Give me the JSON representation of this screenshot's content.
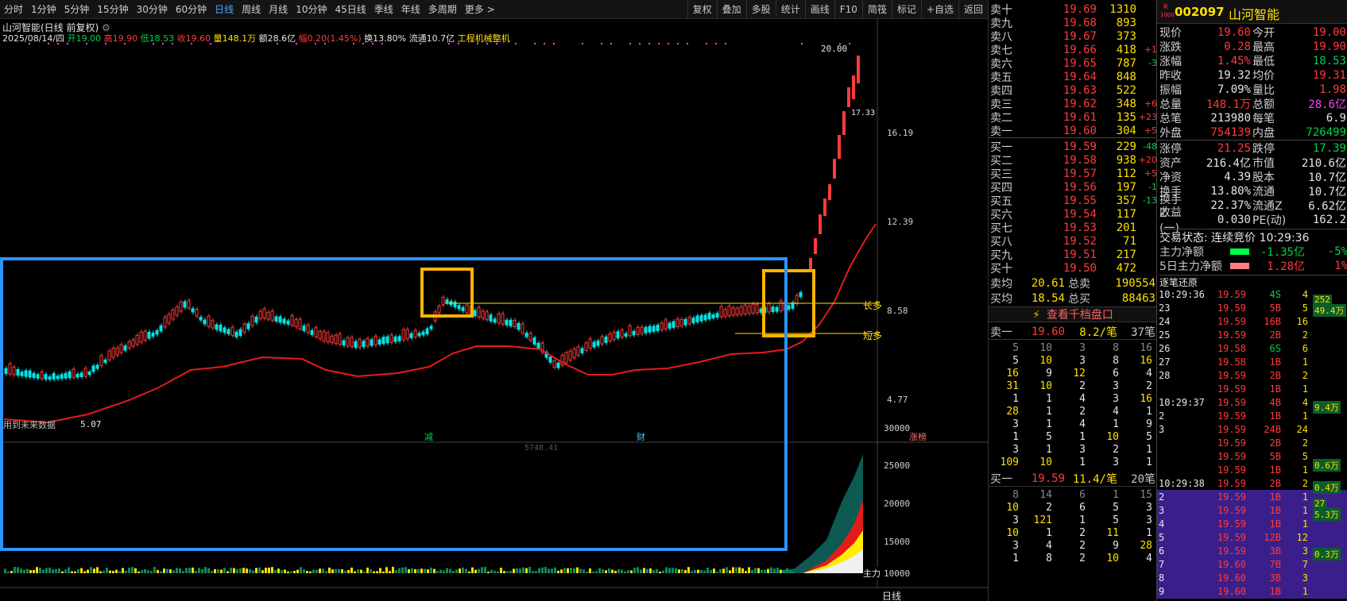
{
  "toolbar": {
    "periods": [
      "分时",
      "1分钟",
      "5分钟",
      "15分钟",
      "30分钟",
      "60分钟",
      "日线",
      "周线",
      "月线",
      "10分钟",
      "45日线",
      "季线",
      "年线",
      "多周期",
      "更多 >"
    ],
    "active_period": "日线",
    "tools": [
      "复权",
      "叠加",
      "多股",
      "统计",
      "画线",
      "F10",
      "简筏",
      "标记",
      "+自选",
      "返回"
    ]
  },
  "chart_header": {
    "title": "山河智能(日线 前复权)",
    "date": "2025/08/14/四",
    "open": "开19.00",
    "high": "高19.90",
    "low": "低18.53",
    "close": "收19.60",
    "volume": "量148.1万",
    "amount": "额28.6亿",
    "change": "幅0.20(1.45%)",
    "turnover": "换13.80%",
    "float": "流通10.7亿",
    "industry": "工程机械整机"
  },
  "price_axis": [
    "16.19",
    "12.39",
    "8.58",
    "4.77"
  ],
  "price_labels": {
    "peak": "20.00",
    "right_marker": "17.33",
    "low_marker": "5.07",
    "long_line": "长多",
    "short_line": "短多"
  },
  "markers": {
    "left_note": "用到未来数据",
    "m1": "减",
    "m2": "财",
    "m3": "涨榜"
  },
  "volume_axis": [
    "30000",
    "25000",
    "20000",
    "15000",
    "10000"
  ],
  "volume_label": "主力",
  "volume_extra": "5748.41",
  "bottom_axis": "日线",
  "orderbook": {
    "asks": [
      {
        "label": "卖十",
        "price": "19.69",
        "vol": "1310",
        "chg": ""
      },
      {
        "label": "卖九",
        "price": "19.68",
        "vol": "893",
        "chg": ""
      },
      {
        "label": "卖八",
        "price": "19.67",
        "vol": "373",
        "chg": ""
      },
      {
        "label": "卖七",
        "price": "19.66",
        "vol": "418",
        "chg": "+1"
      },
      {
        "label": "卖六",
        "price": "19.65",
        "vol": "787",
        "chg": "-3"
      },
      {
        "label": "卖五",
        "price": "19.64",
        "vol": "848",
        "chg": ""
      },
      {
        "label": "卖四",
        "price": "19.63",
        "vol": "522",
        "chg": ""
      },
      {
        "label": "卖三",
        "price": "19.62",
        "vol": "348",
        "chg": "+6"
      },
      {
        "label": "卖二",
        "price": "19.61",
        "vol": "135",
        "chg": "+23"
      },
      {
        "label": "卖一",
        "price": "19.60",
        "vol": "304",
        "chg": "+5"
      }
    ],
    "bids": [
      {
        "label": "买一",
        "price": "19.59",
        "vol": "229",
        "chg": "-48"
      },
      {
        "label": "买二",
        "price": "19.58",
        "vol": "938",
        "chg": "+20"
      },
      {
        "label": "买三",
        "price": "19.57",
        "vol": "112",
        "chg": "+5"
      },
      {
        "label": "买四",
        "price": "19.56",
        "vol": "197",
        "chg": "-1"
      },
      {
        "label": "买五",
        "price": "19.55",
        "vol": "357",
        "chg": "-13"
      },
      {
        "label": "买六",
        "price": "19.54",
        "vol": "117",
        "chg": ""
      },
      {
        "label": "买七",
        "price": "19.53",
        "vol": "201",
        "chg": ""
      },
      {
        "label": "买八",
        "price": "19.52",
        "vol": "71",
        "chg": ""
      },
      {
        "label": "买九",
        "price": "19.51",
        "vol": "217",
        "chg": ""
      },
      {
        "label": "买十",
        "price": "19.50",
        "vol": "472",
        "chg": ""
      }
    ],
    "ask_avg_label": "卖均",
    "ask_avg": "20.61",
    "total_sell_label": "总卖",
    "total_sell": "190554",
    "bid_avg_label": "买均",
    "bid_avg": "18.54",
    "total_buy_label": "总买",
    "total_buy": "88463",
    "depth_button": "查看千档盘口",
    "sell1_summary": {
      "label": "卖一",
      "price": "19.60",
      "per": "8.2/笔",
      "count": "37笔"
    },
    "sell1_grid": [
      [
        "5",
        "10",
        "3",
        "8",
        "16"
      ],
      [
        "5",
        "10",
        "3",
        "8",
        "16"
      ],
      [
        "16",
        "9",
        "12",
        "6",
        "4"
      ],
      [
        "31",
        "10",
        "2",
        "3",
        "2"
      ],
      [
        "1",
        "1",
        "4",
        "3",
        "16"
      ],
      [
        "28",
        "1",
        "2",
        "4",
        "1"
      ],
      [
        "3",
        "1",
        "4",
        "1",
        "9"
      ],
      [
        "1",
        "5",
        "1",
        "10",
        "5"
      ],
      [
        "3",
        "1",
        "3",
        "2",
        "1"
      ],
      [
        "109",
        "10",
        "1",
        "3",
        "1"
      ]
    ],
    "buy1_summary": {
      "label": "买一",
      "price": "19.59",
      "per": "11.4/笔",
      "count": "20笔"
    },
    "buy1_grid": [
      [
        "8",
        "14",
        "6",
        "1",
        "15"
      ],
      [
        "10",
        "2",
        "6",
        "5",
        "3"
      ],
      [
        "3",
        "121",
        "1",
        "5",
        "3"
      ],
      [
        "10",
        "1",
        "2",
        "11",
        "1"
      ],
      [
        "3",
        "4",
        "2",
        "9",
        "28"
      ],
      [
        "1",
        "8",
        "2",
        "10",
        "4"
      ]
    ]
  },
  "quote": {
    "code": "002097",
    "name": "山河智能",
    "rows": [
      {
        "k": "现价",
        "v": "19.60",
        "k2": "今开",
        "v2": "19.00"
      },
      {
        "k": "涨跌",
        "v": "0.28",
        "k2": "最高",
        "v2": "19.90"
      },
      {
        "k": "涨幅",
        "v": "1.45%",
        "k2": "最低",
        "v2": "18.53"
      },
      {
        "k": "昨收",
        "v": "19.32",
        "k2": "均价",
        "v2": "19.31"
      },
      {
        "k": "振幅",
        "v": "7.09%",
        "k2": "量比",
        "v2": "1.98"
      },
      {
        "k": "总量",
        "v": "148.1万",
        "k2": "总额",
        "v2": "28.6亿"
      },
      {
        "k": "总笔",
        "v": "213980",
        "k2": "每笔",
        "v2": "6.9"
      },
      {
        "k": "外盘",
        "v": "754139",
        "k2": "内盘",
        "v2": "726499"
      },
      {
        "k": "涨停",
        "v": "21.25",
        "k2": "跌停",
        "v2": "17.39"
      },
      {
        "k": "资产",
        "v": "216.4亿",
        "k2": "市值",
        "v2": "210.6亿"
      },
      {
        "k": "净资",
        "v": "4.39",
        "k2": "股本",
        "v2": "10.7亿"
      },
      {
        "k": "换手",
        "v": "13.80%",
        "k2": "流通",
        "v2": "10.7亿"
      },
      {
        "k": "换手Z",
        "v": "22.37%",
        "k2": "流通Z",
        "v2": "6.62亿"
      },
      {
        "k": "收益(一)",
        "v": "0.030",
        "k2": "PE(动)",
        "v2": "162.2"
      }
    ],
    "trade_status": "交易状态: 连续竞价 10:29:36",
    "main_net": {
      "label": "主力净额",
      "value": "-1.35亿",
      "pct": "-5%"
    },
    "main_net5": {
      "label": "5日主力净额",
      "value": "1.28亿",
      "pct": "1%"
    }
  },
  "ticks_header": "逐笔还原",
  "ticks": [
    {
      "t": "10:29:36",
      "p": "19.59",
      "v": "4S",
      "n": "4"
    },
    {
      "t": "23",
      "p": "19.59",
      "v": "5B",
      "n": "5"
    },
    {
      "t": "24",
      "p": "19.59",
      "v": "16B",
      "n": "16"
    },
    {
      "t": "25",
      "p": "19.59",
      "v": "2B",
      "n": "2"
    },
    {
      "t": "26",
      "p": "19.58",
      "v": "6S",
      "n": "6"
    },
    {
      "t": "27",
      "p": "19.58",
      "v": "1B",
      "n": "1"
    },
    {
      "t": "28",
      "p": "19.59",
      "v": "2B",
      "n": "2"
    },
    {
      "t": "",
      "p": "19.59",
      "v": "1B",
      "n": "1"
    },
    {
      "t": "10:29:37",
      "p": "19.59",
      "v": "4B",
      "n": "4"
    },
    {
      "t": "2",
      "p": "19.59",
      "v": "1B",
      "n": "1"
    },
    {
      "t": "3",
      "p": "19.59",
      "v": "24B",
      "n": "24"
    },
    {
      "t": "",
      "p": "19.59",
      "v": "2B",
      "n": "2"
    },
    {
      "t": "",
      "p": "19.59",
      "v": "5B",
      "n": "5"
    },
    {
      "t": "",
      "p": "19.59",
      "v": "1B",
      "n": "1"
    },
    {
      "t": "10:29:38",
      "p": "19.59",
      "v": "2B",
      "n": "2"
    },
    {
      "t": "2",
      "p": "19.59",
      "v": "1B",
      "n": "1"
    },
    {
      "t": "3",
      "p": "19.59",
      "v": "1B",
      "n": "1"
    },
    {
      "t": "4",
      "p": "19.59",
      "v": "1B",
      "n": "1"
    },
    {
      "t": "5",
      "p": "19.59",
      "v": "12B",
      "n": "12"
    },
    {
      "t": "6",
      "p": "19.59",
      "v": "3B",
      "n": "3"
    },
    {
      "t": "7",
      "p": "19.60",
      "v": "7B",
      "n": "7"
    },
    {
      "t": "8",
      "p": "19.60",
      "v": "3B",
      "n": "3"
    },
    {
      "t": "9",
      "p": "19.60",
      "v": "1B",
      "n": "1"
    }
  ],
  "tick_side_labels": [
    "252",
    "49.4万",
    "9.4万",
    "0.6万",
    "0.4万",
    "27",
    "5.3万",
    "0.3万"
  ]
}
